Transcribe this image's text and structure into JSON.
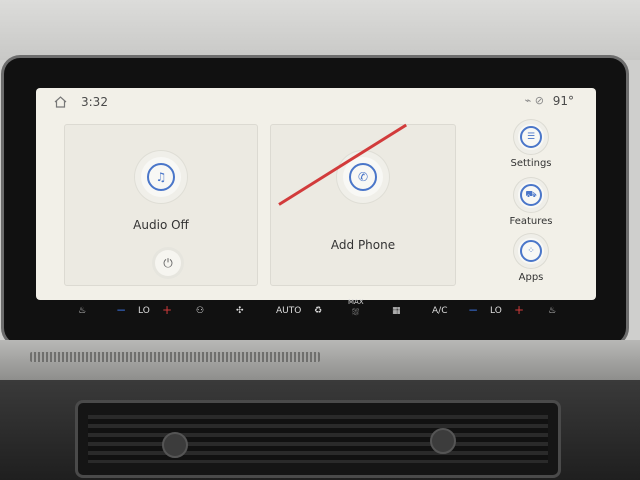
{
  "status": {
    "time": "3:32",
    "temperature": "91°"
  },
  "audio": {
    "label": "Audio Off",
    "icon": "music-note-icon"
  },
  "phone": {
    "label": "Add Phone",
    "icon": "phone-icon"
  },
  "sidebar": {
    "items": [
      {
        "label": "Settings",
        "icon": "sliders-icon"
      },
      {
        "label": "Features",
        "icon": "car-icon"
      },
      {
        "label": "Apps",
        "icon": "grid-icon"
      }
    ]
  },
  "climate": {
    "left_temp": "LO",
    "right_temp": "LO",
    "auto_label": "AUTO",
    "max_label": "MAX",
    "ac_label": "A/C",
    "minus": "−",
    "plus": "+"
  },
  "colors": {
    "accent": "#4a76c9",
    "strike": "#d23b3b",
    "screen_bg": "#f2f0e8"
  }
}
